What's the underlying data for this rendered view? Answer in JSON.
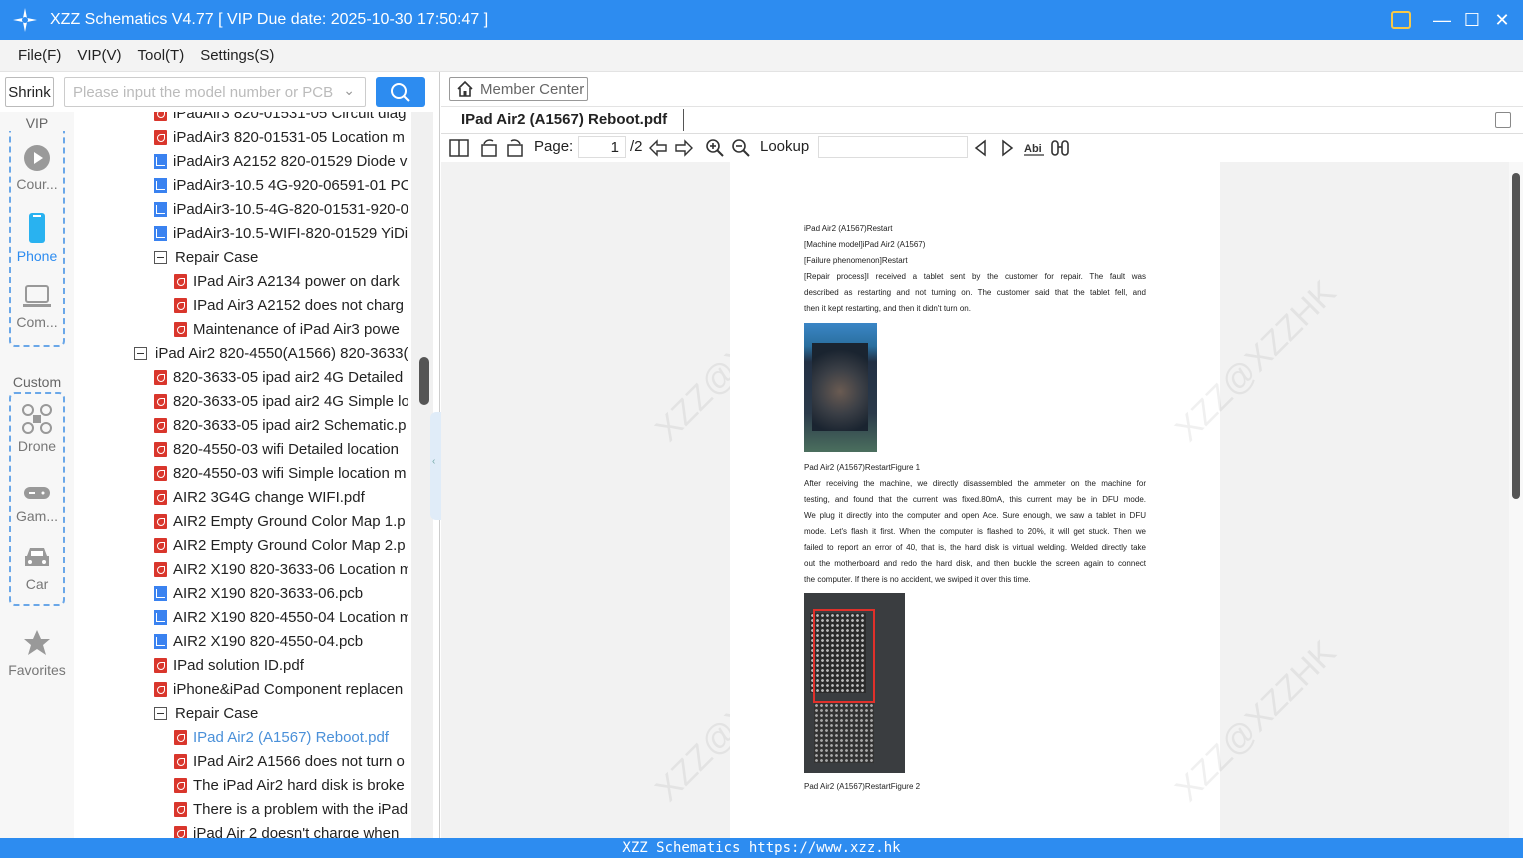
{
  "window": {
    "title": "XZZ Schematics V4.77 [ VIP Due date: 2025-10-30 17:50:47 ]",
    "minimize": "—",
    "maximize": "☐",
    "close": "✕"
  },
  "menu": [
    "File(F)",
    "VIP(V)",
    "Tool(T)",
    "Settings(S)"
  ],
  "left": {
    "shrink_label": "Shrink",
    "search_placeholder": "Please input the model number or PCB",
    "vip_label": "VIP",
    "custom_label": "Custom",
    "nav": [
      {
        "label": "Cour...",
        "icon": "play-icon"
      },
      {
        "label": "Phone",
        "icon": "phone-icon"
      },
      {
        "label": "Com...",
        "icon": "laptop-icon"
      },
      {
        "label": "Drone",
        "icon": "drone-icon"
      },
      {
        "label": "Gam...",
        "icon": "gamepad-icon"
      },
      {
        "label": "Car",
        "icon": "car-icon"
      },
      {
        "label": "Favorites",
        "icon": "star-icon"
      }
    ],
    "tree": [
      {
        "text": "iPadAir3 820-01531-05 Circuit diag",
        "type": "pdf",
        "indent": 1
      },
      {
        "text": "iPadAir3 820-01531-05 Location m",
        "type": "pdf",
        "indent": 1
      },
      {
        "text": "iPadAir3 A2152 820-01529 Diode v",
        "type": "pcb",
        "indent": 1
      },
      {
        "text": "iPadAir3-10.5 4G-920-06591-01 PC",
        "type": "pcb",
        "indent": 1
      },
      {
        "text": "iPadAir3-10.5-4G-820-01531-920-0",
        "type": "pcb",
        "indent": 1
      },
      {
        "text": "iPadAir3-10.5-WIFI-820-01529 YiDi",
        "type": "pcb",
        "indent": 1
      },
      {
        "text": "Repair Case",
        "type": "toggle",
        "indent": 1
      },
      {
        "text": "IPad Air3 A2134 power on dark",
        "type": "pdf",
        "indent": 2
      },
      {
        "text": "IPad Air3 A2152 does not charg",
        "type": "pdf",
        "indent": 2
      },
      {
        "text": "Maintenance of iPad Air3 powe",
        "type": "pdf",
        "indent": 2
      },
      {
        "text": "iPad Air2 820-4550(A1566) 820-3633(",
        "type": "toggle",
        "indent": 0
      },
      {
        "text": "820-3633-05 ipad air2 4G Detailed",
        "type": "pdf",
        "indent": 1
      },
      {
        "text": "820-3633-05 ipad air2 4G Simple lo",
        "type": "pdf",
        "indent": 1
      },
      {
        "text": "820-3633-05 ipad air2 Schematic.p",
        "type": "pdf",
        "indent": 1
      },
      {
        "text": "820-4550-03 wifi Detailed location",
        "type": "pdf",
        "indent": 1
      },
      {
        "text": "820-4550-03 wifi Simple location m",
        "type": "pdf",
        "indent": 1
      },
      {
        "text": "AIR2 3G4G change WIFI.pdf",
        "type": "pdf",
        "indent": 1
      },
      {
        "text": "AIR2 Empty Ground Color Map 1.p",
        "type": "pdf",
        "indent": 1
      },
      {
        "text": "AIR2 Empty Ground Color Map 2.p",
        "type": "pdf",
        "indent": 1
      },
      {
        "text": "AIR2 X190 820-3633-06 Location m",
        "type": "pdf",
        "indent": 1
      },
      {
        "text": "AIR2 X190 820-3633-06.pcb",
        "type": "pcb",
        "indent": 1
      },
      {
        "text": "AIR2 X190 820-4550-04 Location m",
        "type": "pcb",
        "indent": 1
      },
      {
        "text": "AIR2 X190 820-4550-04.pcb",
        "type": "pcb",
        "indent": 1
      },
      {
        "text": "IPad solution ID.pdf",
        "type": "pdf",
        "indent": 1
      },
      {
        "text": "iPhone&iPad Component replacen",
        "type": "pdf",
        "indent": 1
      },
      {
        "text": "Repair Case",
        "type": "toggle",
        "indent": 1
      },
      {
        "text": "IPad Air2 (A1567) Reboot.pdf",
        "type": "pdf",
        "indent": 2,
        "selected": true
      },
      {
        "text": "IPad Air2 A1566 does not turn o",
        "type": "pdf",
        "indent": 2
      },
      {
        "text": "The iPad Air2 hard disk is broke",
        "type": "pdf",
        "indent": 2
      },
      {
        "text": "There is a problem with the iPad",
        "type": "pdf",
        "indent": 2
      },
      {
        "text": "iPad Air 2 doesn't charge when",
        "type": "pdf",
        "indent": 2
      }
    ]
  },
  "right": {
    "member_center": "Member Center",
    "tab_title": "IPad Air2 (A1567) Reboot.pdf",
    "page_label": "Page:",
    "page_current": "1",
    "page_total": "/2",
    "lookup_label": "Lookup",
    "doc": {
      "lines": [
        "iPad Air2 (A1567)Restart",
        "[Machine model]iPad Air2 (A1567)",
        "[Failure phenomenon]Restart",
        "[Repair process]I received a tablet sent by the customer for repair. The fault was",
        "described as restarting and not turning on. The customer said that the tablet fell, and",
        "then it kept restarting, and then it didn't turn on."
      ],
      "caption1": "Pad Air2 (A1567)RestartFigure 1",
      "para2": [
        "After receiving the machine, we directly disassembled the ammeter on the machine for",
        "testing, and found that the current was fixed.80mA, this current may be in DFU mode.",
        "We plug it directly into the computer and open Ace. Sure enough, we saw a tablet in DFU",
        "mode. Let's flash it first. When the computer is flashed to 20%, it will get stuck. Then we",
        "failed to report an error of 40, that is, the hard disk is virtual welding. Welded directly take",
        "out the motherboard and redo the hard disk, and then buckle the screen again to connect",
        "the computer. If there is no accident, we swiped it over this time."
      ],
      "caption2": "Pad Air2 (A1567)RestartFigure 2",
      "watermark": "XZZ@XZZHK"
    }
  },
  "statusbar": "XZZ Schematics https://www.xzz.hk"
}
